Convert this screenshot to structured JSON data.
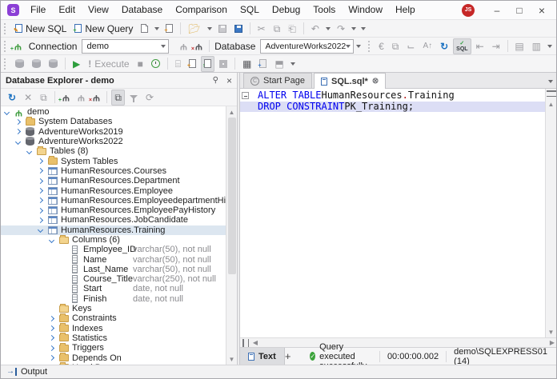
{
  "titlebar": {
    "logo_letter": "S",
    "menu": [
      "File",
      "Edit",
      "View",
      "Database",
      "Comparison",
      "SQL",
      "Debug",
      "Tools",
      "Window",
      "Help"
    ],
    "avatar": "JS",
    "minimize": "–",
    "maximize": "□",
    "close": "×"
  },
  "toolbars": {
    "new_sql": "New SQL",
    "new_query": "New Query",
    "connection_label": "Connection",
    "connection_value": "demo",
    "database_label": "Database",
    "database_value": "AdventureWorks2022",
    "execute_label": "Execute"
  },
  "explorer": {
    "title": "Database Explorer - demo",
    "tree": [
      {
        "level": 0,
        "exp": "open",
        "icon": "plug",
        "label": "demo"
      },
      {
        "level": 1,
        "exp": "closed",
        "icon": "folder",
        "label": "System Databases"
      },
      {
        "level": 1,
        "exp": "closed",
        "icon": "db",
        "label": "AdventureWorks2019"
      },
      {
        "level": 1,
        "exp": "open",
        "icon": "db",
        "label": "AdventureWorks2022"
      },
      {
        "level": 2,
        "exp": "open",
        "icon": "folder-open",
        "label": "Tables (8)"
      },
      {
        "level": 3,
        "exp": "closed",
        "icon": "folder",
        "label": "System Tables"
      },
      {
        "level": 3,
        "exp": "closed",
        "icon": "table",
        "label": "HumanResources.Courses"
      },
      {
        "level": 3,
        "exp": "closed",
        "icon": "table",
        "label": "HumanResources.Department"
      },
      {
        "level": 3,
        "exp": "closed",
        "icon": "table",
        "label": "HumanResources.Employee"
      },
      {
        "level": 3,
        "exp": "closed",
        "icon": "table",
        "label": "HumanResources.EmployeedepartmentHistory"
      },
      {
        "level": 3,
        "exp": "closed",
        "icon": "table",
        "label": "HumanResources.EmployeePayHistory"
      },
      {
        "level": 3,
        "exp": "closed",
        "icon": "table",
        "label": "HumanResources.JobCandidate"
      },
      {
        "level": 3,
        "exp": "open",
        "icon": "table",
        "label": "HumanResources.Training",
        "selected": true
      },
      {
        "level": 4,
        "exp": "open",
        "icon": "folder-open",
        "label": "Columns (6)"
      },
      {
        "level": 5,
        "exp": "none",
        "icon": "column",
        "label": "Employee_ID",
        "type": "varchar(50), not null"
      },
      {
        "level": 5,
        "exp": "none",
        "icon": "column",
        "label": "Name",
        "type": "varchar(50), not null"
      },
      {
        "level": 5,
        "exp": "none",
        "icon": "column",
        "label": "Last_Name",
        "type": "varchar(50), not null"
      },
      {
        "level": 5,
        "exp": "none",
        "icon": "column",
        "label": "Course_Title",
        "type": "varchar(250), not null"
      },
      {
        "level": 5,
        "exp": "none",
        "icon": "column",
        "label": "Start",
        "type": "date, not null"
      },
      {
        "level": 5,
        "exp": "none",
        "icon": "column",
        "label": "Finish",
        "type": "date, not null"
      },
      {
        "level": 4,
        "exp": "none",
        "icon": "folder-open",
        "label": "Keys"
      },
      {
        "level": 4,
        "exp": "closed",
        "icon": "folder",
        "label": "Constraints"
      },
      {
        "level": 4,
        "exp": "closed",
        "icon": "folder",
        "label": "Indexes"
      },
      {
        "level": 4,
        "exp": "closed",
        "icon": "folder",
        "label": "Statistics"
      },
      {
        "level": 4,
        "exp": "closed",
        "icon": "folder",
        "label": "Triggers"
      },
      {
        "level": 4,
        "exp": "closed",
        "icon": "folder",
        "label": "Depends On"
      },
      {
        "level": 4,
        "exp": "closed",
        "icon": "folder",
        "label": "Used By"
      }
    ]
  },
  "editor": {
    "tabs": [
      {
        "label": "Start Page",
        "icon": "start-page",
        "active": false,
        "closable": false
      },
      {
        "label": "SQL.sql*",
        "icon": "sql-document",
        "active": true,
        "closable": true
      }
    ],
    "lines": [
      {
        "selected": false,
        "fold": true,
        "changed": true,
        "tokens": [
          {
            "t": "ALTER TABLE ",
            "s": "kw"
          },
          {
            "t": "HumanResources",
            "s": "id"
          },
          {
            "t": ".",
            "s": "dot"
          },
          {
            "t": "Training",
            "s": "id"
          }
        ]
      },
      {
        "selected": true,
        "fold": false,
        "changed": true,
        "tokens": [
          {
            "t": "DROP CONSTRAINT ",
            "s": "kw"
          },
          {
            "t": "PK_Training",
            "s": "id"
          },
          {
            "t": ";",
            "s": "pu"
          }
        ]
      }
    ]
  },
  "statusbar": {
    "text_tab": "Text",
    "add_tab": "+",
    "message": "Query executed successfully.",
    "duration": "00:00:00.002",
    "server": "demo\\SQLEXPRESS01 (14)"
  },
  "output": {
    "label": "Output"
  },
  "colors": {
    "keyword": "#0000ee",
    "identifier_dot": "#b00000",
    "selection_line": "#dcdef5",
    "change_bar": "#f5d60a",
    "logo_bg": "#8b3fd6",
    "avatar_bg": "#c62828",
    "success": "#3ba33b",
    "tree_selection": "#dce6f0"
  }
}
